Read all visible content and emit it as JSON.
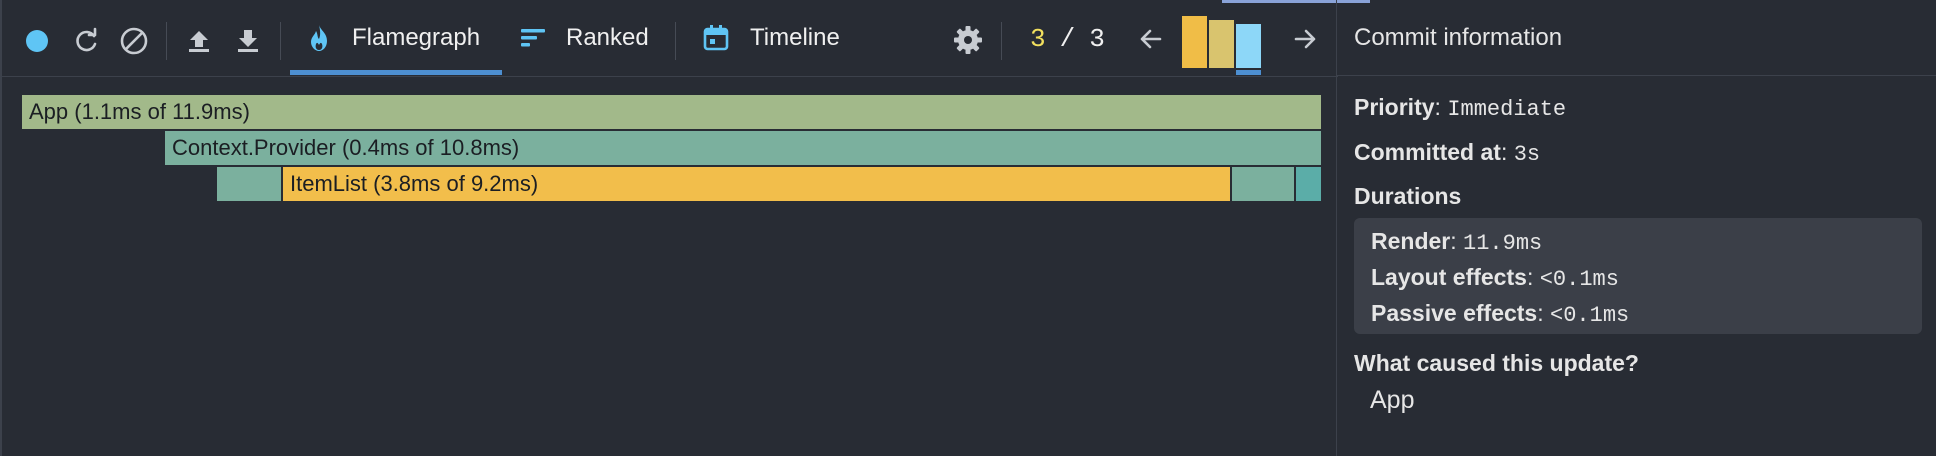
{
  "toolbar": {
    "icons": {
      "record": "record-dot-icon",
      "reload": "reload-icon",
      "clear": "clear-circle-icon",
      "upload": "upload-icon",
      "download": "download-icon",
      "settings": "gear-icon",
      "prev": "arrow-left-icon",
      "next": "arrow-right-icon"
    },
    "tabs": [
      {
        "label": "Flamegraph",
        "icon": "flame-icon",
        "active": true
      },
      {
        "label": "Ranked",
        "icon": "ranked-bars-icon",
        "active": false
      },
      {
        "label": "Timeline",
        "icon": "calendar-icon",
        "active": false
      }
    ],
    "commit_current": "3",
    "commit_sep": "/",
    "commit_total": "3",
    "commit_bars": [
      {
        "fraction": 0.79,
        "color": "#f0bd47",
        "selected": false
      },
      {
        "fraction": 0.72,
        "color": "#d9c46e",
        "selected": false
      },
      {
        "fraction": 0.67,
        "color": "#8dd7f8",
        "selected": true
      }
    ]
  },
  "flamegraph": {
    "frames": [
      {
        "label": "App (1.1ms of 11.9ms)",
        "color": "#a2b98a"
      },
      {
        "label": "Context.Provider (0.4ms of 10.8ms)",
        "color": "#7bb09e"
      },
      {
        "label": "",
        "color": "#7bb09e"
      },
      {
        "label": "ItemList (3.8ms of 9.2ms)",
        "color": "#f2be4b"
      },
      {
        "label": "",
        "color": "#7bb09e"
      },
      {
        "label": "",
        "color": "#5bada8"
      }
    ]
  },
  "commit_info": {
    "header": "Commit information",
    "priority_label": "Priority",
    "priority_value": "Immediate",
    "committed_label": "Committed at",
    "committed_value": "3s",
    "durations_heading": "Durations",
    "render_label": "Render",
    "render_value": "11.9ms",
    "layout_label": "Layout effects",
    "layout_value": "<0.1ms",
    "passive_label": "Passive effects",
    "passive_value": "<0.1ms",
    "cause_heading": "What caused this update?",
    "cause_value": "App"
  },
  "colors": {
    "background": "#282c34",
    "accent_blue": "#4d8fd1",
    "icon_blue": "#5fc5f5",
    "commit_number": "#f2e05e"
  }
}
